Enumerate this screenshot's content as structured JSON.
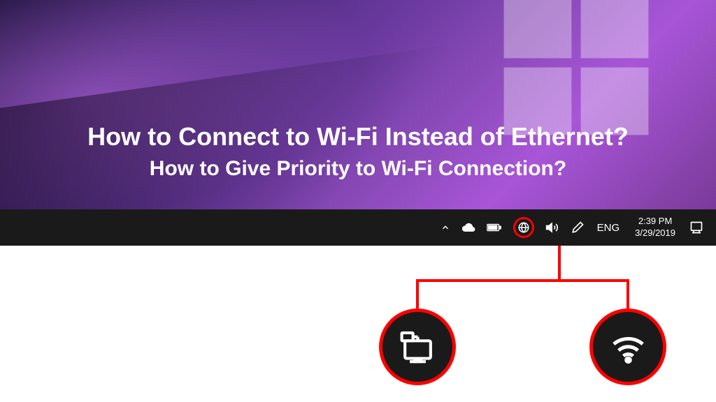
{
  "hero": {
    "title_main": "How to Connect to Wi-Fi Instead of Ethernet?",
    "title_sub": "How to Give Priority to Wi-Fi Connection?"
  },
  "taskbar": {
    "language": "ENG",
    "clock": {
      "time": "2:39 PM",
      "date": "3/29/2019"
    }
  },
  "callout": {
    "ethernet_label": "ethernet",
    "wifi_label": "wifi"
  },
  "accent_color": "#ff0000"
}
